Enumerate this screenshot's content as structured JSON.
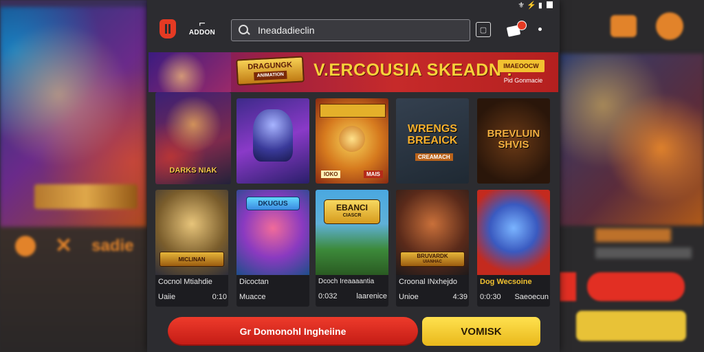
{
  "status_bar": {
    "text": "⚜ ⚡ ▮"
  },
  "header": {
    "brand_mark": "⌐",
    "brand_text": "ADDON",
    "search_value": "Ineadadieclin"
  },
  "banner": {
    "logo_line1": "DRAGUNGK",
    "logo_line2": "ANIMATION",
    "title": "V.ERCOUSIA SKEADN !",
    "button": "IMAEOOCW",
    "subtext": "Pid Gonmacie"
  },
  "feature": {
    "title": "DARKS NIAK"
  },
  "tiles_row1": [
    {
      "title": "",
      "tag": "",
      "colors": [
        "#3d2a8a",
        "#8a3ac8"
      ]
    },
    {
      "title": "",
      "tag": "IOKO",
      "tag2": "MAIS",
      "colors": [
        "#e0a42a",
        "#b4391d"
      ]
    },
    {
      "title": "WRENGS BREAICK",
      "tag": "CREAMACH",
      "colors": [
        "#2f3a4a",
        "#1f2933"
      ]
    },
    {
      "title": "BREVLUIN SHVIS",
      "tag": "",
      "colors": [
        "#4a2a12",
        "#2a160a"
      ]
    }
  ],
  "cards": [
    {
      "banner1": "MICLINAN",
      "banner2": "",
      "name": "Cocnol Mtiahdie",
      "meta_left": "Uaiie",
      "meta_right": "0:10"
    },
    {
      "banner1": "DKUGUS",
      "banner2": "",
      "name": "Dicoctan",
      "meta_left": "Muacce",
      "meta_right": ""
    },
    {
      "banner1": "EBANCI",
      "banner2": "CIASCR",
      "name": "Dcoch Ireaaaantia",
      "meta_left": "0:032",
      "meta_right": "laarenice"
    },
    {
      "banner1": "BRUVARDK",
      "banner2": "UIANHAC",
      "name": "Croonal INxhejdo",
      "meta_left": "Unioe",
      "meta_right": "4:39"
    },
    {
      "banner1": "",
      "banner2": "",
      "name": "Dog Wecsoine",
      "meta_left": "0:0:30",
      "meta_right": "Saeoecun"
    }
  ],
  "cta": {
    "primary": "Gr Domonohl Ingheiine",
    "secondary": "VOMISK"
  },
  "background_left": {
    "label": "sadie"
  },
  "colors": {
    "accent_red": "#e53a23",
    "accent_yellow": "#f2c230",
    "panel": "#2c2c30"
  }
}
